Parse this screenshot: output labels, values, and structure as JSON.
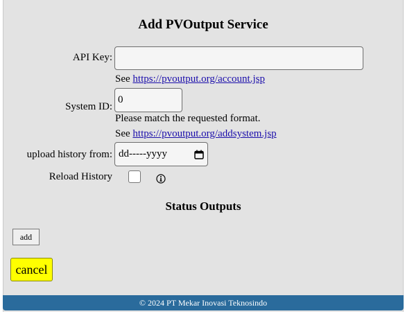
{
  "form": {
    "title": "Add PVOutput Service",
    "api_key": {
      "label": "API Key:",
      "value": "",
      "hint_prefix": "See ",
      "hint_link": "https://pvoutput.org/account.jsp"
    },
    "system_id": {
      "label": "System ID:",
      "value": "0",
      "validation_message": "Please match the requested format.",
      "hint_prefix": "See ",
      "hint_link": "https://pvoutput.org/addsystem.jsp"
    },
    "upload_history": {
      "label": "upload history from:",
      "placeholder": "dd-----yyyy",
      "icon": "calendar-icon"
    },
    "reload_history": {
      "label": "Reload History",
      "checked": false,
      "info_icon": "info-icon"
    }
  },
  "status_outputs": {
    "title": "Status Outputs",
    "add_label": "add"
  },
  "actions": {
    "cancel_label": "cancel"
  },
  "footer": {
    "text": "© 2024 PT Mekar Inovasi Teknosindo"
  },
  "colors": {
    "background": "#e3e3e3",
    "footer": "#2a6b9c",
    "cancel_button": "#ffff00",
    "link": "#1a0dab"
  }
}
